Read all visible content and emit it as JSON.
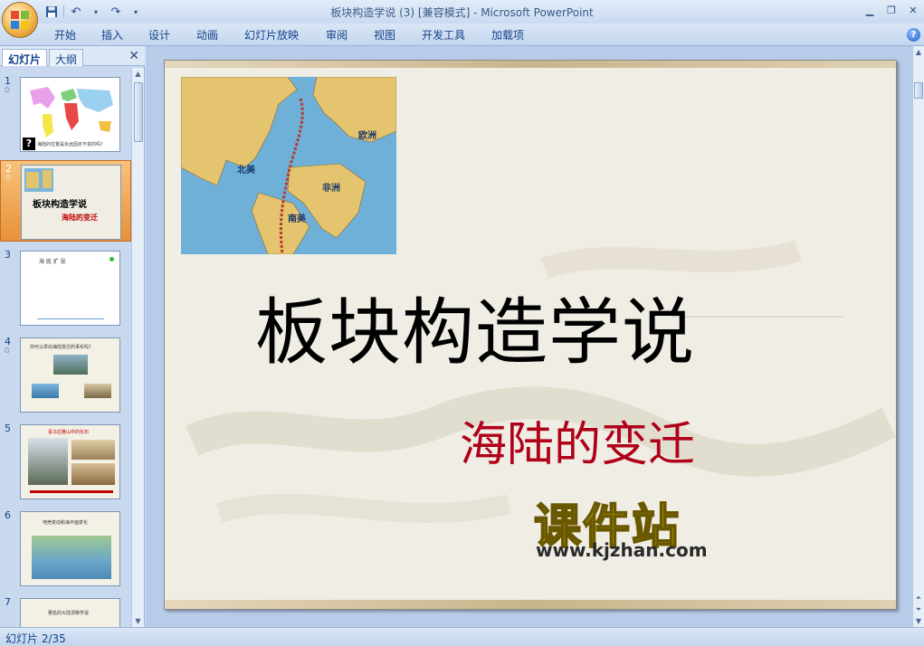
{
  "window": {
    "title": "板块构造学说 (3) [兼容模式] - Microsoft PowerPoint"
  },
  "quick_access": {
    "icons": [
      "save-icon",
      "undo-icon",
      "redo-icon",
      "customize-icon"
    ]
  },
  "ribbon": {
    "tabs": [
      {
        "label": "开始"
      },
      {
        "label": "插入"
      },
      {
        "label": "设计"
      },
      {
        "label": "动画"
      },
      {
        "label": "幻灯片放映"
      },
      {
        "label": "审阅"
      },
      {
        "label": "视图"
      },
      {
        "label": "开发工具"
      },
      {
        "label": "加载项"
      }
    ],
    "help": "?"
  },
  "left_pane": {
    "tabs": [
      {
        "label": "幻灯片"
      },
      {
        "label": "大纲"
      }
    ],
    "thumbnails": [
      {
        "number": "1",
        "caption": "海陆的位置是永远固定不变的吗？",
        "question_mark": "?"
      },
      {
        "number": "2",
        "title": "板块构造学说",
        "subtitle": "海陆的变迁"
      },
      {
        "number": "3",
        "caption": "海 底 扩 张"
      },
      {
        "number": "4",
        "caption": "你可以举出海陆变迁的事实吗？"
      },
      {
        "number": "5",
        "caption": "喜马拉雅山中的化石"
      },
      {
        "number": "6",
        "caption": "地壳变动和海平面变化"
      },
      {
        "number": "7",
        "caption": "著名的大陆漂移学说"
      }
    ]
  },
  "slide": {
    "title": "板块构造学说",
    "subtitle": "海陆的变迁",
    "map_labels": {
      "europe": "欧洲",
      "north_america": "北美",
      "africa": "非洲",
      "south_america": "南美"
    }
  },
  "watermark": {
    "name": "课件站",
    "url": "www.kjzhan.com"
  },
  "status_bar": {
    "slide_info": "幻灯片 2/35"
  },
  "colors": {
    "title": "#000000",
    "subtitle": "#b00019",
    "ribbon": "#c4d7ef",
    "selected_thumb": "#e8913a",
    "watermark": "#f7e600"
  }
}
